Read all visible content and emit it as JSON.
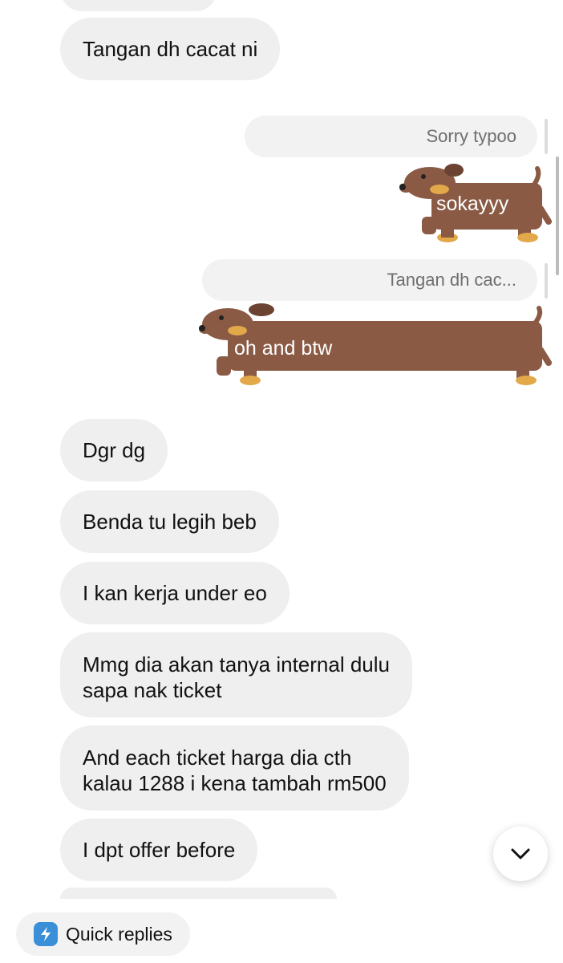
{
  "messages_in_top": [
    {
      "text": "Tangan dh cacat ni"
    }
  ],
  "reply_refs": [
    {
      "text": "Sorry typoo"
    },
    {
      "text": "Tangan dh cac..."
    }
  ],
  "stickers": [
    {
      "label": "sokayyy",
      "icon": "dachshund-sticker"
    },
    {
      "label": "oh and btw",
      "icon": "long-dachshund-sticker"
    }
  ],
  "messages_in": [
    {
      "text": "Dgr dg"
    },
    {
      "text": "Benda tu legih beb"
    },
    {
      "text": "I kan kerja under eo"
    },
    {
      "line1": "Mmg dia akan tanya internal dulu",
      "line2": "sapa nak ticket"
    },
    {
      "line1": "And each ticket harga dia cth",
      "line2": "kalau 1288 i kena tambah rm500"
    },
    {
      "text": "I dpt offer before"
    }
  ],
  "composer": {
    "quick_replies_label": "Quick replies",
    "quick_replies_icon": "lightning-bolt-icon"
  },
  "controls": {
    "scroll_down_icon": "chevron-down-icon"
  },
  "colors": {
    "incoming_bubble": "#efefef",
    "sticker_body": "#8a5a45",
    "accent": "#3a8fd8"
  }
}
